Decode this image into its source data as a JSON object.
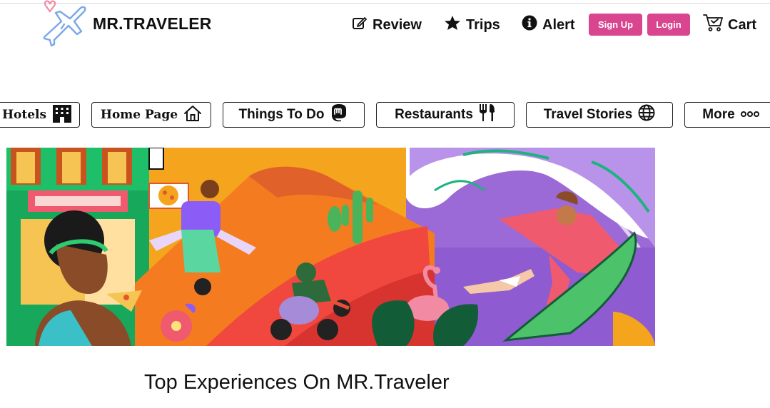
{
  "header": {
    "brand": "MR.TRAVELER",
    "nav": {
      "review": "Review",
      "trips": "Trips",
      "alert": "Alert",
      "signup": "Sign Up",
      "login": "Login",
      "cart": "Cart"
    }
  },
  "categories": {
    "hotels": "Hotels",
    "home": "Home Page",
    "things": "Things To Do",
    "restaurants": "Restaurants",
    "stories": "Travel Stories",
    "more": "More"
  },
  "main": {
    "section_title": "Top Experiences On MR.Traveler"
  },
  "colors": {
    "accent": "#d9458f",
    "text": "#111111",
    "logo_blue": "#7aa7e8",
    "logo_pink": "#f28aa4"
  },
  "icons": {
    "logo": "airplane-heart-logo",
    "review": "edit-icon",
    "trips": "star-icon",
    "alert": "info-icon",
    "cart": "cart-icon",
    "hotels": "building-icon",
    "home": "home-icon",
    "things": "mastodon-icon",
    "restaurants": "utensils-icon",
    "stories": "globe-icon",
    "more": "dots-icon"
  }
}
